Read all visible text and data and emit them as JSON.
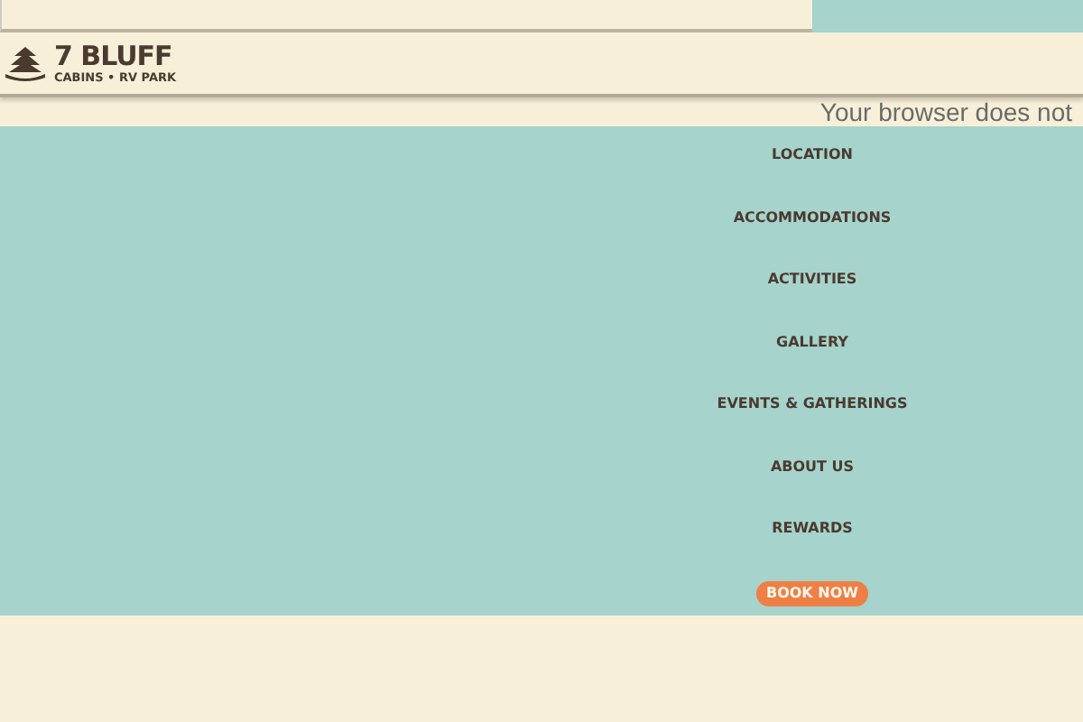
{
  "logo": {
    "name": "7 BLUFF",
    "tagline": "CABINS • RV PARK"
  },
  "notice": "Your browser does not",
  "nav": [
    {
      "label": "LOCATION",
      "kind": "link"
    },
    {
      "label": "ACCOMMODATIONS",
      "kind": "link"
    },
    {
      "label": "ACTIVITIES",
      "kind": "link"
    },
    {
      "label": "GALLERY",
      "kind": "link"
    },
    {
      "label": "EVENTS & GATHERINGS",
      "kind": "link"
    },
    {
      "label": "ABOUT US",
      "kind": "link"
    },
    {
      "label": "REWARDS",
      "kind": "link"
    },
    {
      "label": "BOOK NOW",
      "kind": "button"
    }
  ]
}
